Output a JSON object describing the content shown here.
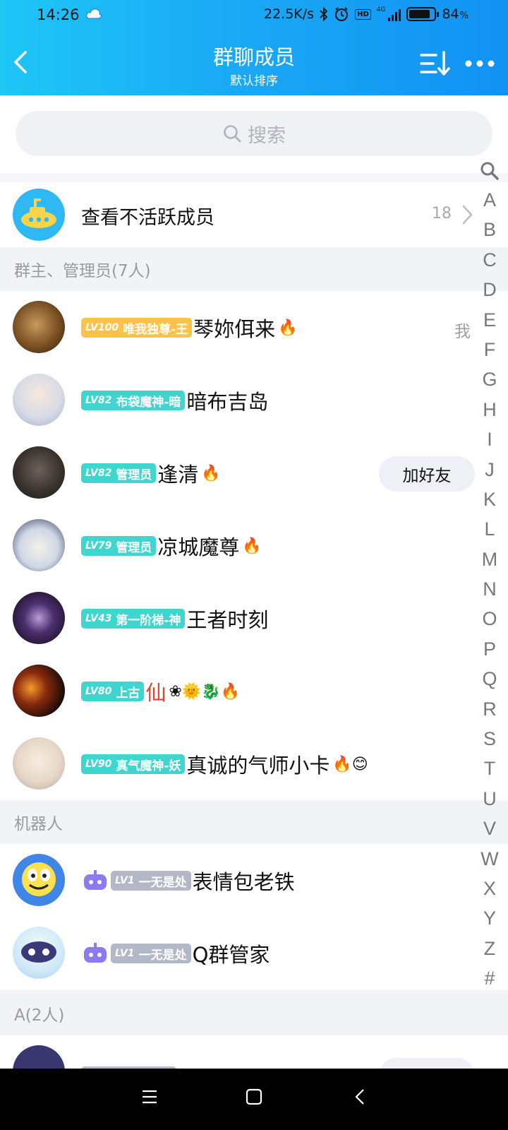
{
  "status_bar": {
    "time": "14:26",
    "speed": "22.5K/s",
    "network": "4G",
    "hd": "HD",
    "battery_pct": "84",
    "battery_unit": "%",
    "battery_level": 0.84
  },
  "header": {
    "title": "群聊成员",
    "subtitle": "默认排序"
  },
  "search": {
    "placeholder": "搜索"
  },
  "inactive": {
    "label": "查看不活跃成员",
    "count": "18"
  },
  "sections": {
    "admins": "群主、管理员(7人)",
    "robots": "机器人",
    "a_group": "A(2人)"
  },
  "members": [
    {
      "lv": "LV100",
      "title": "唯我独尊-王",
      "name": "琴妳佴来",
      "emoji": "🔥",
      "right": "我"
    },
    {
      "lv": "LV82",
      "title": "布袋魔神-暗",
      "name": "暗布吉岛",
      "emoji": ""
    },
    {
      "lv": "LV82",
      "title": "管理员",
      "name": "逢清",
      "emoji": "🔥",
      "button": "加好友"
    },
    {
      "lv": "LV79",
      "title": "管理员",
      "name": "凉城魔尊",
      "emoji": "🔥"
    },
    {
      "lv": "LV43",
      "title": "第一阶梯-神",
      "name": "王者时刻",
      "emoji": ""
    },
    {
      "lv": "LV80",
      "title": "上古",
      "name": "仙",
      "emoji": "❀🌞🐉🔥"
    },
    {
      "lv": "LV90",
      "title": "真气魔神-妖",
      "name": "真诚的气师小卡",
      "emoji": "🔥😊"
    }
  ],
  "robots": [
    {
      "lv": "LV1",
      "title": "一无是处",
      "name": "表情包老铁"
    },
    {
      "lv": "LV1",
      "title": "一无是处",
      "name": "Q群管家"
    }
  ],
  "index_letters": [
    "A",
    "B",
    "C",
    "D",
    "E",
    "F",
    "G",
    "H",
    "I",
    "J",
    "K",
    "L",
    "M",
    "N",
    "O",
    "P",
    "Q",
    "R",
    "S",
    "T",
    "U",
    "V",
    "W",
    "X",
    "Y",
    "Z",
    "#"
  ],
  "colors": {
    "header_start": "#1fc6f6",
    "header_end": "#1292f3",
    "gold_badge": "#fcc24a",
    "teal_badge": "#3fd6cf",
    "robot_badge": "#b3b8c7"
  }
}
